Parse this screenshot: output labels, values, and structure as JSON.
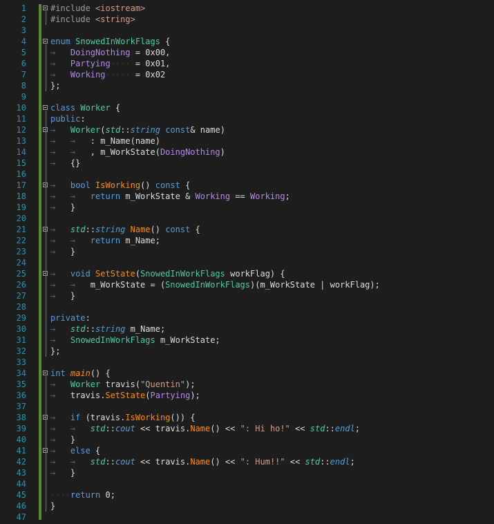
{
  "editor": {
    "lines": [
      {
        "n": "1",
        "tokens": [
          [
            "pp",
            "#include "
          ],
          [
            "inc",
            "<iostream>"
          ]
        ]
      },
      {
        "n": "2",
        "tokens": [
          [
            "pp",
            "#include "
          ],
          [
            "inc",
            "<string>"
          ]
        ]
      },
      {
        "n": "3",
        "tokens": []
      },
      {
        "n": "4",
        "tokens": [
          [
            "kw",
            "enum "
          ],
          [
            "ty",
            "SnowedInWorkFlags"
          ],
          [
            "d",
            " {"
          ]
        ]
      },
      {
        "n": "5",
        "tokens": [
          [
            "tab",
            "→   "
          ],
          [
            "ev",
            "DoingNothing"
          ],
          [
            "d",
            " = 0x00,"
          ]
        ]
      },
      {
        "n": "6",
        "tokens": [
          [
            "tab",
            "→   "
          ],
          [
            "ev",
            "Partying"
          ],
          [
            "dot",
            "····"
          ],
          [
            "d",
            " = 0x01,"
          ]
        ]
      },
      {
        "n": "7",
        "tokens": [
          [
            "tab",
            "→   "
          ],
          [
            "ev",
            "Working"
          ],
          [
            "dot",
            "·····"
          ],
          [
            "d",
            " = 0x02"
          ]
        ]
      },
      {
        "n": "8",
        "tokens": [
          [
            "d",
            "};"
          ]
        ]
      },
      {
        "n": "9",
        "tokens": []
      },
      {
        "n": "10",
        "tokens": [
          [
            "kw",
            "class "
          ],
          [
            "ty",
            "Worker"
          ],
          [
            "d",
            " {"
          ]
        ]
      },
      {
        "n": "11",
        "tokens": [
          [
            "kw",
            "public"
          ],
          [
            "d",
            ":"
          ]
        ]
      },
      {
        "n": "12",
        "tokens": [
          [
            "tab",
            "→   "
          ],
          [
            "ty",
            "Worker"
          ],
          [
            "d",
            "("
          ],
          [
            "ns it",
            "std"
          ],
          [
            "d",
            "::"
          ],
          [
            "kw it",
            "string"
          ],
          [
            "d",
            " "
          ],
          [
            "kw",
            "const"
          ],
          [
            "d",
            "& name)"
          ]
        ]
      },
      {
        "n": "13",
        "tokens": [
          [
            "tab",
            "→   →   "
          ],
          [
            "d",
            ": m_Name(name)"
          ]
        ]
      },
      {
        "n": "14",
        "tokens": [
          [
            "tab",
            "→   →   "
          ],
          [
            "d",
            ", m_WorkState("
          ],
          [
            "ev",
            "DoingNothing"
          ],
          [
            "d",
            ")"
          ]
        ]
      },
      {
        "n": "15",
        "tokens": [
          [
            "tab",
            "→   "
          ],
          [
            "d",
            "{}"
          ]
        ]
      },
      {
        "n": "16",
        "tokens": []
      },
      {
        "n": "17",
        "tokens": [
          [
            "tab",
            "→   "
          ],
          [
            "kw",
            "bool "
          ],
          [
            "fn",
            "IsWorking"
          ],
          [
            "d",
            "() "
          ],
          [
            "kw",
            "const"
          ],
          [
            "d",
            " {"
          ]
        ]
      },
      {
        "n": "18",
        "tokens": [
          [
            "tab",
            "→   →   "
          ],
          [
            "kw",
            "return "
          ],
          [
            "d",
            "m_WorkState & "
          ],
          [
            "ev",
            "Working"
          ],
          [
            "d",
            " == "
          ],
          [
            "ev",
            "Working"
          ],
          [
            "d",
            ";"
          ]
        ]
      },
      {
        "n": "19",
        "tokens": [
          [
            "tab",
            "→   "
          ],
          [
            "d",
            "}"
          ]
        ]
      },
      {
        "n": "20",
        "tokens": []
      },
      {
        "n": "21",
        "tokens": [
          [
            "tab",
            "→   "
          ],
          [
            "ns it",
            "std"
          ],
          [
            "d",
            "::"
          ],
          [
            "kw it",
            "string"
          ],
          [
            "d",
            " "
          ],
          [
            "fn",
            "Name"
          ],
          [
            "d",
            "() "
          ],
          [
            "kw",
            "const"
          ],
          [
            "d",
            " {"
          ]
        ]
      },
      {
        "n": "22",
        "tokens": [
          [
            "tab",
            "→   →   "
          ],
          [
            "kw",
            "return "
          ],
          [
            "d",
            "m_Name;"
          ]
        ]
      },
      {
        "n": "23",
        "tokens": [
          [
            "tab",
            "→   "
          ],
          [
            "d",
            "}"
          ]
        ]
      },
      {
        "n": "24",
        "tokens": []
      },
      {
        "n": "25",
        "tokens": [
          [
            "tab",
            "→   "
          ],
          [
            "kw",
            "void "
          ],
          [
            "fn",
            "SetState"
          ],
          [
            "d",
            "("
          ],
          [
            "ty",
            "SnowedInWorkFlags"
          ],
          [
            "d",
            " workFlag) {"
          ]
        ]
      },
      {
        "n": "26",
        "tokens": [
          [
            "tab",
            "→   →   "
          ],
          [
            "d",
            "m_WorkState = ("
          ],
          [
            "ty",
            "SnowedInWorkFlags"
          ],
          [
            "d",
            ")(m_WorkState | workFlag);"
          ]
        ]
      },
      {
        "n": "27",
        "tokens": [
          [
            "tab",
            "→   "
          ],
          [
            "d",
            "}"
          ]
        ]
      },
      {
        "n": "28",
        "tokens": []
      },
      {
        "n": "29",
        "tokens": [
          [
            "kw",
            "private"
          ],
          [
            "d",
            ":"
          ]
        ]
      },
      {
        "n": "30",
        "tokens": [
          [
            "tab",
            "→   "
          ],
          [
            "ns it",
            "std"
          ],
          [
            "d",
            "::"
          ],
          [
            "kw it",
            "string"
          ],
          [
            "d",
            " m_Name;"
          ]
        ]
      },
      {
        "n": "31",
        "tokens": [
          [
            "tab",
            "→   "
          ],
          [
            "ty",
            "SnowedInWorkFlags"
          ],
          [
            "d",
            " m_WorkState;"
          ]
        ]
      },
      {
        "n": "32",
        "tokens": [
          [
            "d",
            "};"
          ]
        ]
      },
      {
        "n": "33",
        "tokens": []
      },
      {
        "n": "34",
        "tokens": [
          [
            "kw",
            "int "
          ],
          [
            "fn it",
            "main"
          ],
          [
            "d",
            "() {"
          ]
        ]
      },
      {
        "n": "35",
        "tokens": [
          [
            "tab",
            "→   "
          ],
          [
            "ty",
            "Worker"
          ],
          [
            "d",
            " travis("
          ],
          [
            "str",
            "\"Quentin\""
          ],
          [
            "d",
            ");"
          ]
        ]
      },
      {
        "n": "36",
        "tokens": [
          [
            "tab",
            "→   "
          ],
          [
            "d",
            "travis."
          ],
          [
            "fn",
            "SetState"
          ],
          [
            "d",
            "("
          ],
          [
            "ev",
            "Partying"
          ],
          [
            "d",
            ");"
          ]
        ]
      },
      {
        "n": "37",
        "tokens": []
      },
      {
        "n": "38",
        "tokens": [
          [
            "tab",
            "→   "
          ],
          [
            "kw",
            "if"
          ],
          [
            "d",
            " (travis."
          ],
          [
            "fn",
            "IsWorking"
          ],
          [
            "d",
            "()) {"
          ]
        ]
      },
      {
        "n": "39",
        "tokens": [
          [
            "tab",
            "→   →   "
          ],
          [
            "ns it",
            "std"
          ],
          [
            "d",
            "::"
          ],
          [
            "kw it",
            "cout"
          ],
          [
            "d",
            " << travis."
          ],
          [
            "fn",
            "Name"
          ],
          [
            "d",
            "() << "
          ],
          [
            "str",
            "\": Hi ho!\""
          ],
          [
            "d",
            " << "
          ],
          [
            "ns it",
            "std"
          ],
          [
            "d",
            "::"
          ],
          [
            "kw it",
            "endl"
          ],
          [
            "d",
            ";"
          ]
        ]
      },
      {
        "n": "40",
        "tokens": [
          [
            "tab",
            "→   "
          ],
          [
            "d",
            "}"
          ]
        ]
      },
      {
        "n": "41",
        "tokens": [
          [
            "tab",
            "→   "
          ],
          [
            "kw",
            "else"
          ],
          [
            "d",
            " {"
          ]
        ]
      },
      {
        "n": "42",
        "tokens": [
          [
            "tab",
            "→   →   "
          ],
          [
            "ns it",
            "std"
          ],
          [
            "d",
            "::"
          ],
          [
            "kw it",
            "cout"
          ],
          [
            "d",
            " << travis."
          ],
          [
            "fn",
            "Name"
          ],
          [
            "d",
            "() << "
          ],
          [
            "str",
            "\": Hum!!\""
          ],
          [
            "d",
            " << "
          ],
          [
            "ns it",
            "std"
          ],
          [
            "d",
            "::"
          ],
          [
            "kw it",
            "endl"
          ],
          [
            "d",
            ";"
          ]
        ]
      },
      {
        "n": "43",
        "tokens": [
          [
            "tab",
            "→   "
          ],
          [
            "d",
            "}"
          ]
        ]
      },
      {
        "n": "44",
        "tokens": []
      },
      {
        "n": "45",
        "tokens": [
          [
            "dot",
            "····"
          ],
          [
            "kw",
            "return "
          ],
          [
            "d",
            "0;"
          ]
        ]
      },
      {
        "n": "46",
        "tokens": [
          [
            "d",
            "}"
          ]
        ]
      },
      {
        "n": "47",
        "tokens": []
      }
    ],
    "fold_lines": [
      "1",
      "4",
      "10",
      "12",
      "17",
      "21",
      "25",
      "34",
      "38",
      "41"
    ],
    "colors": {
      "background": "#1e1e1e",
      "line_number": "#2b91af",
      "keyword": "#569cd6",
      "type": "#4ec9b0",
      "enum_value": "#b388ea",
      "function": "#ff8c00",
      "string": "#d69d85",
      "change_bar": "#5a8a32"
    }
  }
}
